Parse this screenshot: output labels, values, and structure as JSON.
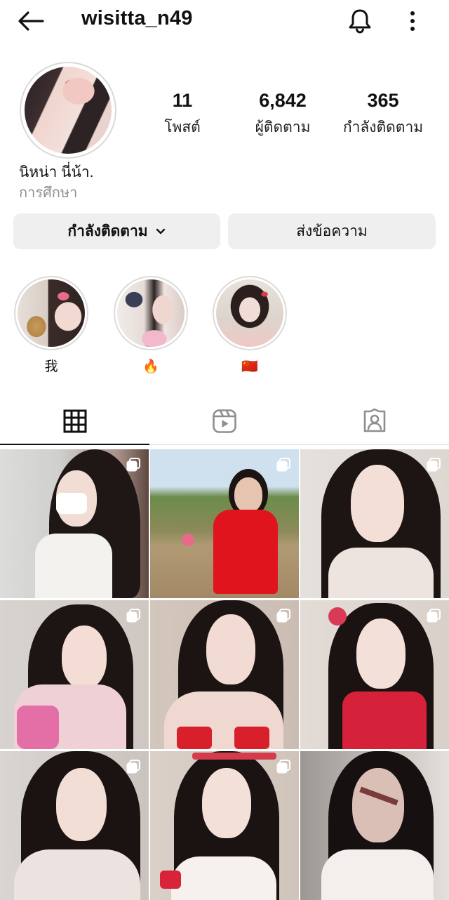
{
  "header": {
    "username": "wisitta_n49",
    "back_icon": "arrow-left-icon",
    "notification_icon": "bell-icon",
    "more_icon": "more-vertical-icon"
  },
  "profile": {
    "display_name": "นิหน่า นี่น้า.",
    "category": "การศึกษา",
    "stats": [
      {
        "value": "11",
        "label": "โพสต์"
      },
      {
        "value": "6,842",
        "label": "ผู้ติดตาม"
      },
      {
        "value": "365",
        "label": "กำลังติดตาม"
      }
    ]
  },
  "actions": {
    "following_label": "กำลังติดตาม",
    "message_label": "ส่งข้อความ"
  },
  "highlights": [
    {
      "label": "我"
    },
    {
      "label": "🔥"
    },
    {
      "label": "🇨🇳"
    }
  ],
  "tabs": [
    {
      "name": "posts",
      "icon": "grid-icon",
      "active": true
    },
    {
      "name": "reels",
      "icon": "reels-icon",
      "active": false
    },
    {
      "name": "tagged",
      "icon": "tagged-person-icon",
      "active": false
    }
  ],
  "posts": [
    {
      "multi": true
    },
    {
      "multi": true
    },
    {
      "multi": true
    },
    {
      "multi": true
    },
    {
      "multi": true
    },
    {
      "multi": true
    },
    {
      "multi": true
    },
    {
      "multi": true
    },
    {
      "multi": false
    }
  ],
  "colors": {
    "button_bg": "#efefef",
    "secondary_text": "#8e8e8e",
    "divider": "#dbdbdb",
    "text": "#111111"
  }
}
